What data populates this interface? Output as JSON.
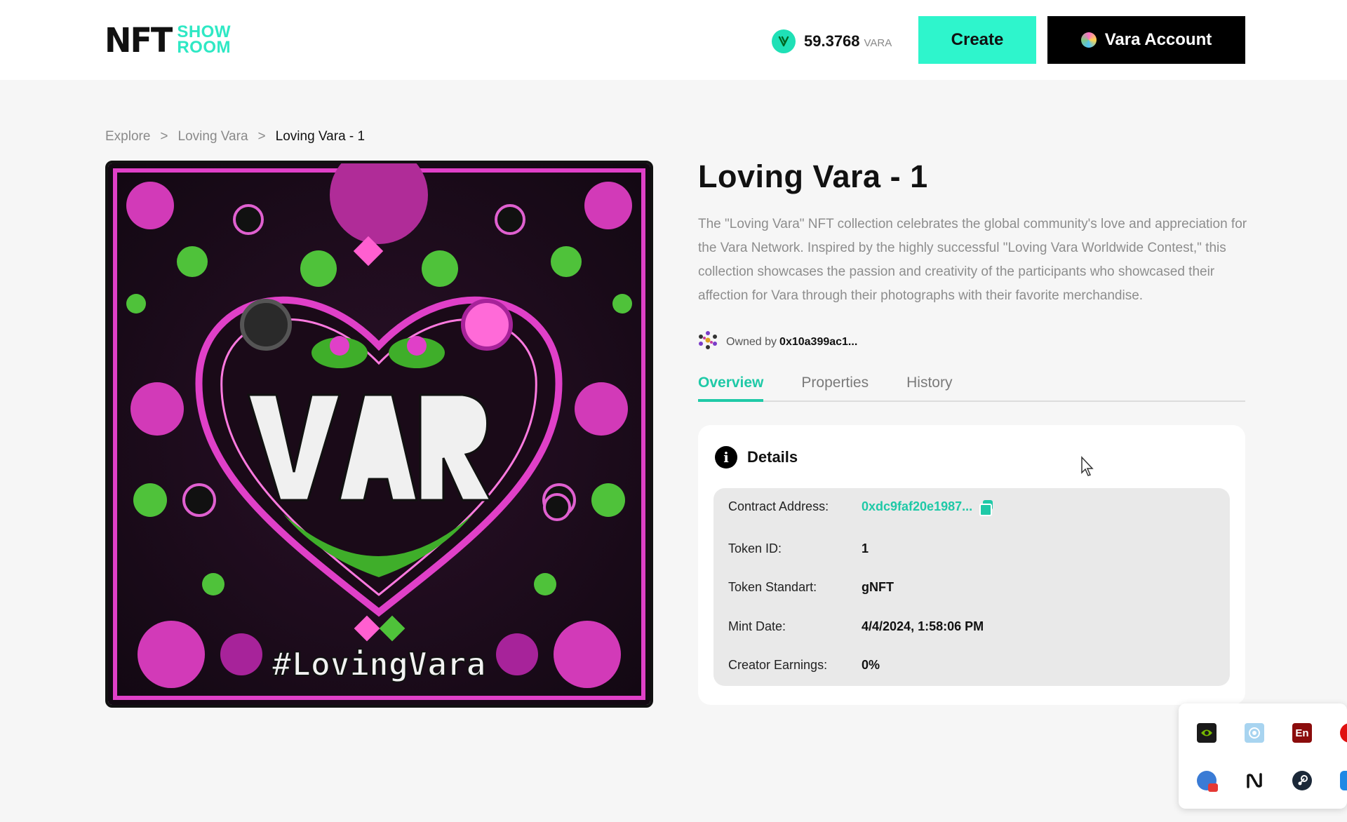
{
  "header": {
    "logo_mark": "NFT",
    "logo_line1": "SHOW",
    "logo_line2": "ROOM",
    "balance_amount": "59.3768",
    "balance_unit": "VARA",
    "create_label": "Create",
    "account_label": "Vara Account"
  },
  "breadcrumb": {
    "items": [
      "Explore",
      "Loving Vara",
      "Loving Vara - 1"
    ],
    "separator": ">"
  },
  "nft": {
    "image_caption": "#LovingVara",
    "title": "Loving Vara - 1",
    "description": "The \"Loving Vara\" NFT collection celebrates the global community's love and appreciation for the Vara Network. Inspired by the highly successful \"Loving Vara Worldwide Contest,\" this collection showcases the passion and creativity of the participants who showcased their affection for Vara through their photographs with their favorite merchandise.",
    "owner_prefix": "Owned by",
    "owner_address": "0x10a399ac1..."
  },
  "tabs": [
    {
      "label": "Overview",
      "active": true
    },
    {
      "label": "Properties",
      "active": false
    },
    {
      "label": "History",
      "active": false
    }
  ],
  "details": {
    "heading": "Details",
    "rows": [
      {
        "label": "Contract Address:",
        "value": "0xdc9faf20e1987..."
      },
      {
        "label": "Token ID:",
        "value": "1"
      },
      {
        "label": "Token Standart:",
        "value": "gNFT"
      },
      {
        "label": "Mint Date:",
        "value": "4/4/2024, 1:58:06 PM"
      },
      {
        "label": "Creator Earnings:",
        "value": "0%"
      }
    ]
  },
  "tray": {
    "icons": [
      "nvidia-icon",
      "network-icon",
      "dictionary-icon",
      "red-app-icon",
      "notification-icon",
      "notion-icon",
      "steam-icon",
      "shield-icon"
    ],
    "dictionary_label": "En"
  },
  "colors": {
    "accent": "#1fc9a7",
    "create_button": "#2ef5cc",
    "account_button": "#000000",
    "page_bg": "#f6f6f6"
  }
}
